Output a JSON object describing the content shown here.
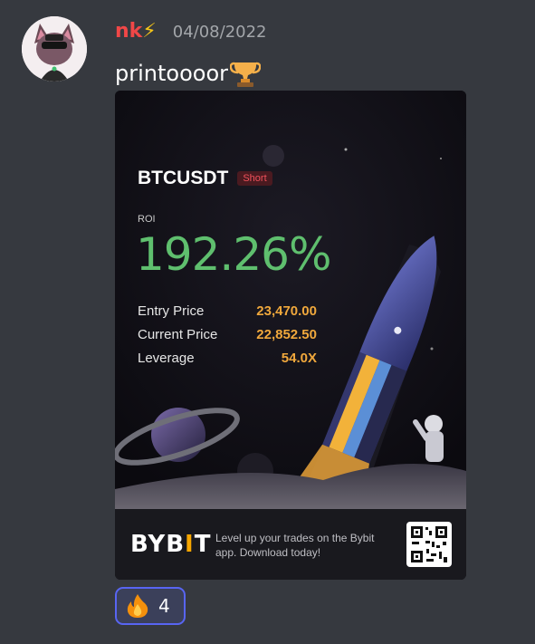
{
  "message": {
    "username": "nk",
    "username_emoji": "⚡",
    "timestamp": "04/08/2022",
    "text": "printoooor",
    "text_emoji": "trophy-icon"
  },
  "card": {
    "pair": "BTCUSDT",
    "side": "Short",
    "roi_label": "ROI",
    "roi_value": "192.26%",
    "stats": [
      {
        "label": "Entry Price",
        "value": "23,470.00"
      },
      {
        "label": "Current Price",
        "value": "22,852.50"
      },
      {
        "label": "Leverage",
        "value": "54.0X"
      }
    ],
    "brand": {
      "pre": "BYB",
      "bar": "I",
      "post": "T"
    },
    "tagline_line1": "Level up your trades on the Bybit",
    "tagline_line2": "app. Download today!"
  },
  "reaction": {
    "emoji": "fire-icon",
    "count": "4"
  },
  "colors": {
    "username": "#f04747",
    "roi": "#5fbf6e",
    "stat_value": "#f0a83c",
    "reaction_border": "#5865f2"
  }
}
